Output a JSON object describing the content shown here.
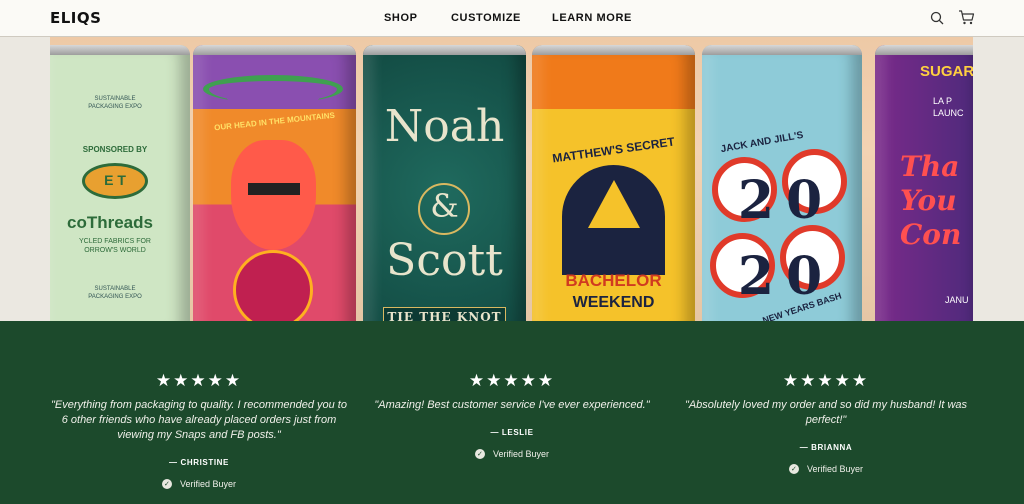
{
  "header": {
    "logo": "ELIQS",
    "nav": [
      "SHOP",
      "CUSTOMIZE",
      "LEARN MORE"
    ],
    "icons": [
      "search-icon",
      "cart-icon"
    ]
  },
  "hero": {
    "cans": [
      {
        "top": "SUSTAINABLE PACKAGING EXPO",
        "sponsor": "SPONSORED BY",
        "badge": "E T",
        "brand": "coThreads",
        "sub": "YCLED FABRICS FOR ORROW'S WORLD",
        "bottom": "SUSTAINABLE PACKAGING EXPO"
      },
      {
        "arc": "OUR HEAD IN THE MOUNTAINS"
      },
      {
        "line1": "Noah",
        "amp": "&",
        "line2": "Scott",
        "tag": "TIE THE KNOT"
      },
      {
        "top": "MATTHEW'S SECRET",
        "line1": "BACHELOR",
        "line2": "WEEKEND"
      },
      {
        "top": "JACK AND JILL'S",
        "year": "2020",
        "bottom": "NEW YEARS BASH"
      },
      {
        "top": "SUGAR",
        "sub": "LA P LAUNC",
        "script": "Tha You Con",
        "bottom": "JANU"
      }
    ]
  },
  "reviews": [
    {
      "stars": "★★★★★",
      "quote": "\"Everything from packaging to quality. I recommended you to 6 other friends who have already placed orders just from viewing my Snaps and FB posts.\"",
      "author": "— CHRISTINE",
      "verified": "Verified Buyer"
    },
    {
      "stars": "★★★★★",
      "quote": "\"Amazing! Best customer service I've ever experienced.\"",
      "author": "— LESLIE",
      "verified": "Verified Buyer"
    },
    {
      "stars": "★★★★★",
      "quote": "\"Absolutely loved my order and so did my husband! It was perfect!\"",
      "author": "— BRIANNA",
      "verified": "Verified Buyer"
    }
  ],
  "colors": {
    "reviews_bg": "#1c4a2c",
    "header_bg": "#fbfaf6"
  }
}
